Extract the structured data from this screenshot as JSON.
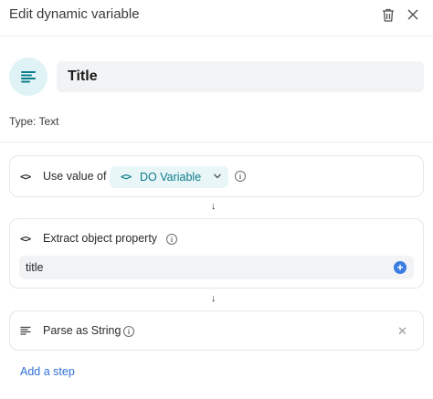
{
  "header": {
    "title": "Edit dynamic variable",
    "trash_icon": "trash-icon",
    "close_icon": "close-icon"
  },
  "variable": {
    "icon": "text-lines-icon",
    "name": "Title",
    "type_label": "Type: Text"
  },
  "steps": [
    {
      "label": "Use value of",
      "select_value": "DO Variable",
      "icon": "code-icon"
    },
    {
      "label": "Extract object property",
      "property_value": "title",
      "icon": "code-icon"
    },
    {
      "label": "Parse as String",
      "icon": "text-lines-icon"
    }
  ],
  "add_step_label": "Add a step",
  "colors": {
    "accent": "#0b7c8a",
    "accent_bg": "#e9f6f8",
    "link": "#2f6fd8",
    "add_button": "#3a7de0"
  }
}
